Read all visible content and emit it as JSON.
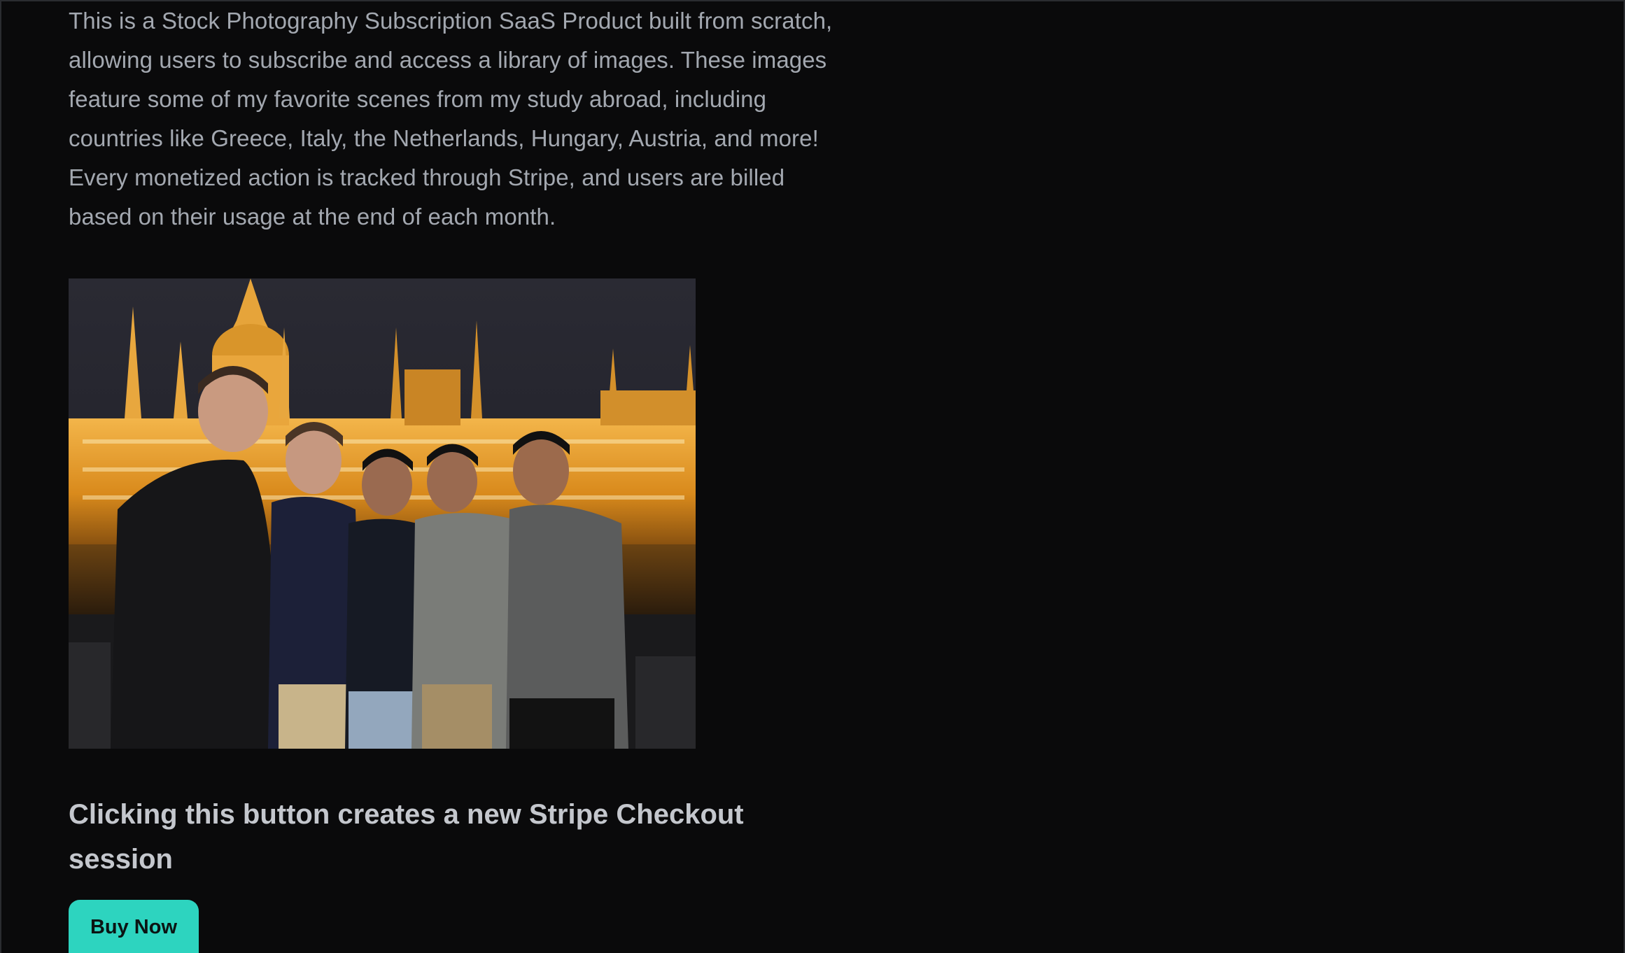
{
  "intro": {
    "lines": [
      "This is a Stock Photography Subscription SaaS Product built from scratch,",
      "allowing users to subscribe and access a library of images. These images",
      "feature some of my favorite scenes from my study abroad, including",
      "countries like Greece, Italy, the Netherlands, Hungary, Austria, and more!",
      "Every monetized action is tracked through Stripe, and users are billed",
      "based on their usage at the end of each month."
    ]
  },
  "checkout": {
    "heading_lines": [
      "Clicking this button creates a new Stripe Checkout",
      "session"
    ],
    "button_label": "Buy Now"
  },
  "colors": {
    "page_background": "#0a0a0b",
    "body_text": "#a3a8b0",
    "heading_text": "#c4c7cd",
    "button_accent": "#2dd4bf"
  }
}
